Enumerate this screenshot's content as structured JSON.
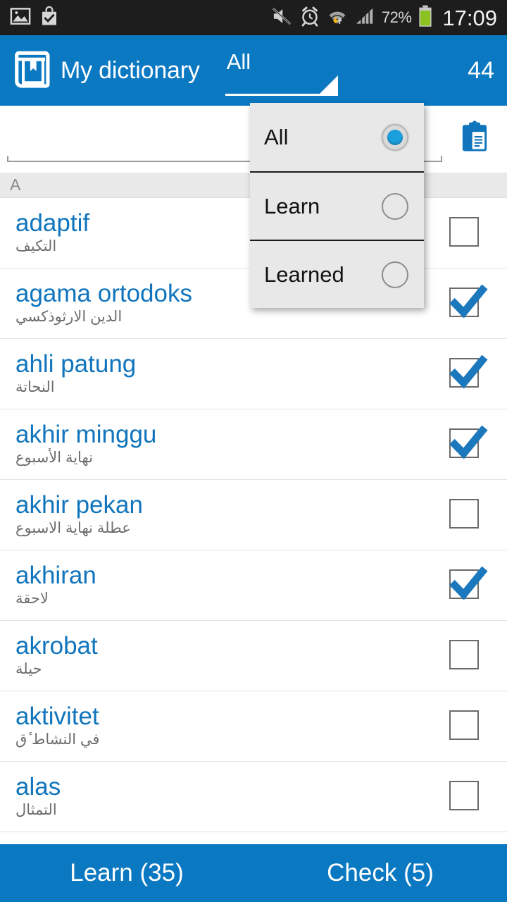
{
  "status_bar": {
    "icons": [
      "image-icon",
      "shopping-bag-check-icon",
      "mute-icon",
      "alarm-icon",
      "wifi-data-icon",
      "signal-bars-icon"
    ],
    "battery_percent": "72%",
    "time": "17:09",
    "background_color": "#1d1d1d"
  },
  "app_bar": {
    "logo_icon": "book-bookmark-icon",
    "title": "My dictionary",
    "spinner_value": "All",
    "count": "44",
    "background_color": "#0b78c2"
  },
  "search": {
    "value": "",
    "placeholder": "",
    "clipboard_icon": "clipboard-icon"
  },
  "section": {
    "letter": "A"
  },
  "dropdown": {
    "visible": true,
    "options": [
      {
        "label": "All",
        "selected": true
      },
      {
        "label": "Learn",
        "selected": false
      },
      {
        "label": "Learned",
        "selected": false
      }
    ],
    "selected_color": "#1ba0dd"
  },
  "words": [
    {
      "term": "adaptif",
      "translation": "التكيف",
      "checked": false
    },
    {
      "term": "agama ortodoks",
      "translation": "الدين الارثوذكسي",
      "checked": true
    },
    {
      "term": "ahli patung",
      "translation": "النحاتة",
      "checked": true
    },
    {
      "term": "akhir minggu",
      "translation": "نهاية الأسبوع",
      "checked": true
    },
    {
      "term": "akhir pekan",
      "translation": "عطلة نهاية الاسبوع",
      "checked": false
    },
    {
      "term": "akhiran",
      "translation": "لاحقة",
      "checked": true
    },
    {
      "term": "akrobat",
      "translation": "حيلة",
      "checked": false
    },
    {
      "term": "aktivitet",
      "translation": "في النشاط ٔق",
      "checked": false
    },
    {
      "term": "alas",
      "translation": "التمثال",
      "checked": false
    }
  ],
  "bottom_bar": {
    "learn_label": "Learn (35)",
    "check_label": "Check (5)",
    "background_color": "#0b78c2"
  },
  "theme": {
    "accent": "#0b78c2",
    "term_color": "#1075bd",
    "translation_color": "#6d6d6d"
  }
}
